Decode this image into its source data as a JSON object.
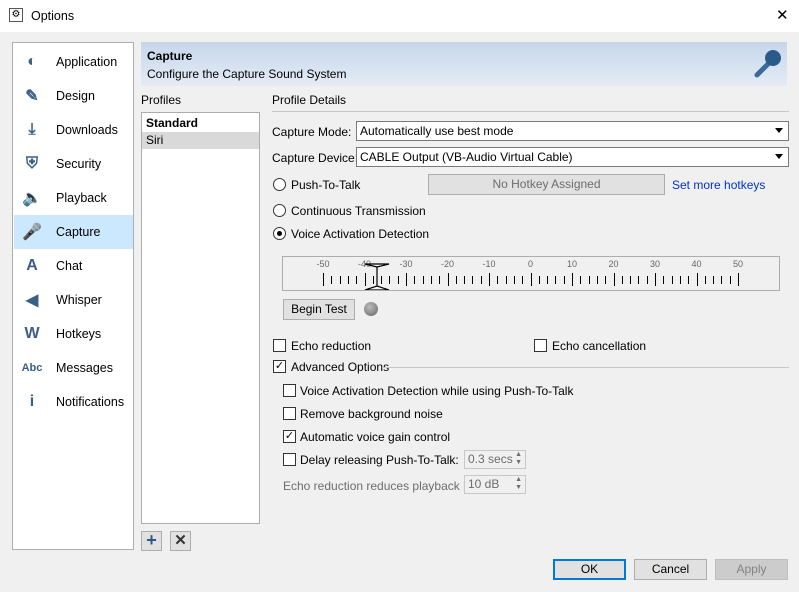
{
  "window": {
    "title": "Options",
    "close": "✕"
  },
  "nav": [
    {
      "label": "Application",
      "icon": "teamspeak-icon"
    },
    {
      "label": "Design",
      "icon": "pencil-icon"
    },
    {
      "label": "Downloads",
      "icon": "download-icon"
    },
    {
      "label": "Security",
      "icon": "shield-icon"
    },
    {
      "label": "Playback",
      "icon": "speaker-icon"
    },
    {
      "label": "Capture",
      "icon": "microphone-icon",
      "selected": true
    },
    {
      "label": "Chat",
      "icon": "chat-icon"
    },
    {
      "label": "Whisper",
      "icon": "whisper-icon"
    },
    {
      "label": "Hotkeys",
      "icon": "hotkeys-icon"
    },
    {
      "label": "Messages",
      "icon": "abc-icon"
    },
    {
      "label": "Notifications",
      "icon": "info-icon"
    }
  ],
  "header": {
    "title": "Capture",
    "subtitle": "Configure the Capture Sound System"
  },
  "profiles": {
    "label": "Profiles",
    "items": [
      "Standard",
      "Siri"
    ],
    "selected": "Siri"
  },
  "details": {
    "label": "Profile Details",
    "capture_mode_label": "Capture Mode:",
    "capture_mode": "Automatically use best mode",
    "capture_device_label": "Capture Device:",
    "capture_device": "CABLE Output (VB-Audio Virtual Cable)",
    "ptt": "Push-To-Talk",
    "no_hotkey": "No Hotkey Assigned",
    "set_hotkeys": "Set more hotkeys",
    "continuous": "Continuous Transmission",
    "vad": "Voice Activation Detection",
    "selected_mode": "vad",
    "slider": {
      "ticks": [
        "-50",
        "-40",
        "-30",
        "-20",
        "-10",
        "0",
        "10",
        "20",
        "30",
        "40",
        "50"
      ],
      "value": -37,
      "min": -50,
      "max": 50
    },
    "begin_test": "Begin Test",
    "echo_reduction": "Echo reduction",
    "echo_cancellation": "Echo cancellation",
    "advanced": "Advanced Options",
    "vad_ptt": "Voice Activation Detection while using Push-To-Talk",
    "remove_noise": "Remove background noise",
    "agc": "Automatic voice gain control",
    "delay_ptt": "Delay releasing Push-To-Talk:",
    "delay_value": "0.3 secs",
    "echo_reduces": "Echo reduction reduces playback by:",
    "echo_value": "10 dB"
  },
  "buttons": {
    "ok": "OK",
    "cancel": "Cancel",
    "apply": "Apply"
  },
  "check": "✓",
  "accent": "#0078d7"
}
